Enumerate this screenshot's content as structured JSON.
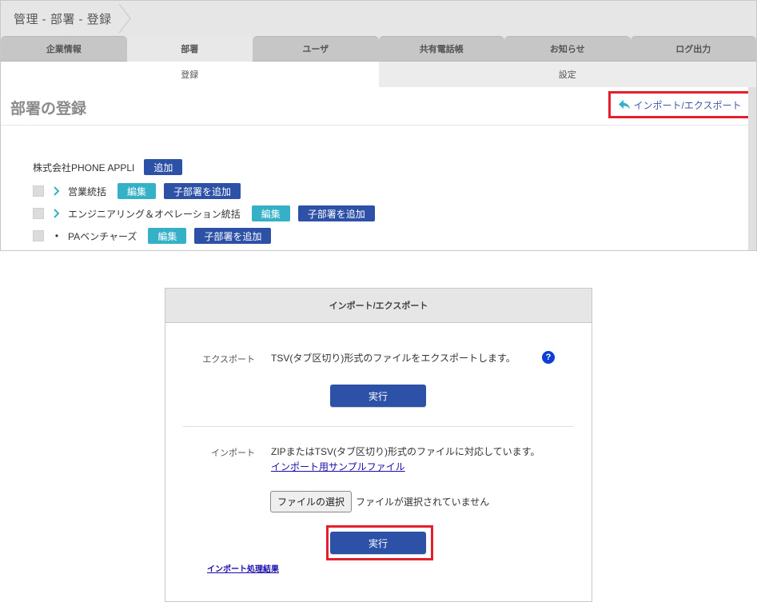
{
  "breadcrumb": "管理 - 部署 - 登録",
  "tabs": [
    {
      "label": "企業情報",
      "active": false
    },
    {
      "label": "部署",
      "active": true
    },
    {
      "label": "ユーザ",
      "active": false
    },
    {
      "label": "共有電話帳",
      "active": false
    },
    {
      "label": "お知らせ",
      "active": false
    },
    {
      "label": "ログ出力",
      "active": false
    }
  ],
  "subtabs": [
    {
      "label": "登録",
      "active": true
    },
    {
      "label": "設定",
      "active": false
    }
  ],
  "page": {
    "title": "部署の登録",
    "import_export_link": "インポート/エクスポート",
    "import_export_icon": "reply-arrow-icon"
  },
  "tree": {
    "root": {
      "label": "株式会社PHONE APPLI",
      "add_label": "追加"
    },
    "items": [
      {
        "label": "営業統括",
        "expander": "chevron-right",
        "edit_label": "編集",
        "add_child_label": "子部署を追加"
      },
      {
        "label": "エンジニアリング＆オペレーション統括",
        "expander": "chevron-right",
        "edit_label": "編集",
        "add_child_label": "子部署を追加"
      },
      {
        "label": "PAベンチャーズ",
        "expander": "bullet",
        "edit_label": "編集",
        "add_child_label": "子部署を追加"
      }
    ]
  },
  "modal": {
    "title": "インポート/エクスポート",
    "export": {
      "label": "エクスポート",
      "description": "TSV(タブ区切り)形式のファイルをエクスポートします。",
      "help_icon": "?",
      "execute_label": "実行"
    },
    "import": {
      "label": "インポート",
      "description": "ZIPまたはTSV(タブ区切り)形式のファイルに対応しています。",
      "sample_link": "インポート用サンプルファイル",
      "file_button": "ファイルの選択",
      "file_status": "ファイルが選択されていません",
      "execute_label": "実行"
    },
    "result_link": "インポート処理結果"
  },
  "colors": {
    "accent_navy": "#2c51a6",
    "accent_cyan": "#35b1c7",
    "highlight_red": "#e5202e",
    "link_blue": "#1a0dab",
    "help_blue": "#0d3fd6"
  }
}
